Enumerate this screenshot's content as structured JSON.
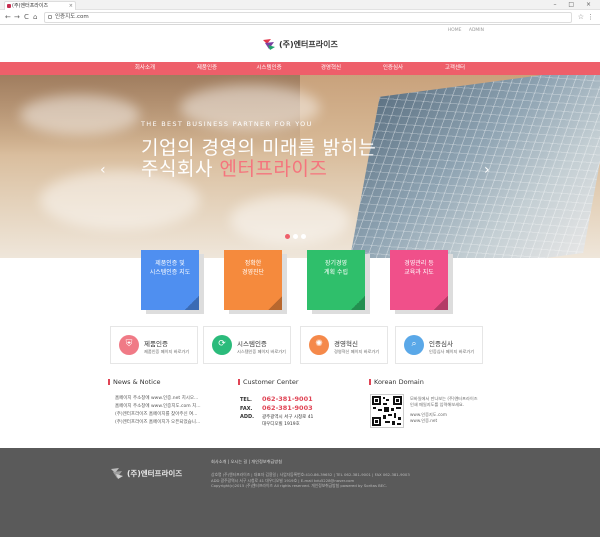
{
  "browser": {
    "tab_title": "(주)엔터프라이즈",
    "tab_close": "×",
    "window_controls": "– □ ×",
    "url": "인증지도.com",
    "back": "←",
    "forward": "→",
    "reload": "C",
    "home": "⌂",
    "star": "☆",
    "menu": "⋮"
  },
  "header": {
    "util_links": [
      "HOME",
      "ADMIN"
    ],
    "logo_text": "(주)엔터프라이즈"
  },
  "nav": {
    "items": [
      "회사소개",
      "제품인증",
      "시스템인증",
      "경영혁신",
      "인증심사",
      "고객센터"
    ]
  },
  "hero": {
    "tagline": "THE BEST BUSINESS PARTNER FOR YOU",
    "line1": "기업의 경영의 미래를 밝히는",
    "line2_prefix": "주식회사 ",
    "line2_accent": "엔터프라이즈",
    "prev_arrow": "‹",
    "next_arrow": "›",
    "slide_count": 3,
    "active_slide": 1
  },
  "tiles": [
    {
      "line1": "제품인증 및",
      "line2": "시스템인증 지도",
      "color": "#4f8ff0"
    },
    {
      "line1": "정확한",
      "line2": "경영진단",
      "color": "#f58a3d"
    },
    {
      "line1": "장기경영",
      "line2": "계획 수립",
      "color": "#2fbf6b"
    },
    {
      "line1": "경영관리 등",
      "line2": "교육과 지도",
      "color": "#f0508a"
    }
  ],
  "services": [
    {
      "name": "제품인증",
      "desc": "제품인증 페이지 바로가기",
      "color": "#f07a86",
      "icon": "shield-icon",
      "glyph": "⛨"
    },
    {
      "name": "시스템인증",
      "desc": "시스템인증 페이지 바로가기",
      "color": "#2bbb7b",
      "icon": "cycle-icon",
      "glyph": "⟳"
    },
    {
      "name": "경영혁신",
      "desc": "경영혁신 페이지 바로가기",
      "color": "#f5894a",
      "icon": "bulb-icon",
      "glyph": "✺"
    },
    {
      "name": "인증심사",
      "desc": "인증심사 페이지 바로가기",
      "color": "#5aa8e8",
      "icon": "search-icon",
      "glyph": "⌕"
    }
  ],
  "news": {
    "title": "News & Notice",
    "items": [
      "홈페이지 주소창에 www.인증.net 치시오...",
      "홈페이지 주소창에 www.인증지도.com 치...",
      "(주)엔터프라이즈 홈페이지를 찾아주신 여...",
      "(주)엔터프라이즈 홈페이지가 오픈되었습니..."
    ]
  },
  "customer_center": {
    "title": "Customer Center",
    "rows": [
      {
        "label": "TEL.",
        "value": "062-381-9001"
      },
      {
        "label": "FAX.",
        "value": "062-381-9003"
      },
      {
        "label": "ADD.",
        "value": "광주광역시 서구 시청로 41"
      }
    ],
    "address_line2": "대우디오빌 1919호"
  },
  "korean_domain": {
    "title": "Korean Domain",
    "desc_line1": "모바일에서 만나보는 (주)엔터프라이즈",
    "desc_line2": "인쇄 매일지도를 입력해보세요.",
    "domain1": "www.인증지도.com",
    "domain2": "www.인증.net"
  },
  "footer": {
    "logo_text": "(주)엔터프라이즈",
    "links": "회사소개 | 오시는 길 | 개인정보취급방침",
    "info1": "상호명 (주)엔터프라이즈 | 대표자 김용일 | 사업자등록번호:410-86-39652 | TEL 062-381-9001 | FAX 062-381-9003",
    "info2": "ADD 광주광역시 서구 시청로 41 대우디오빌 1919호 | E-mail kdu5228@naver.com",
    "info3": "Copyright(c)2015 (주)엔터프라이즈 All rights reserved. 개인정보취급방침 powered by Soritas BEC."
  }
}
